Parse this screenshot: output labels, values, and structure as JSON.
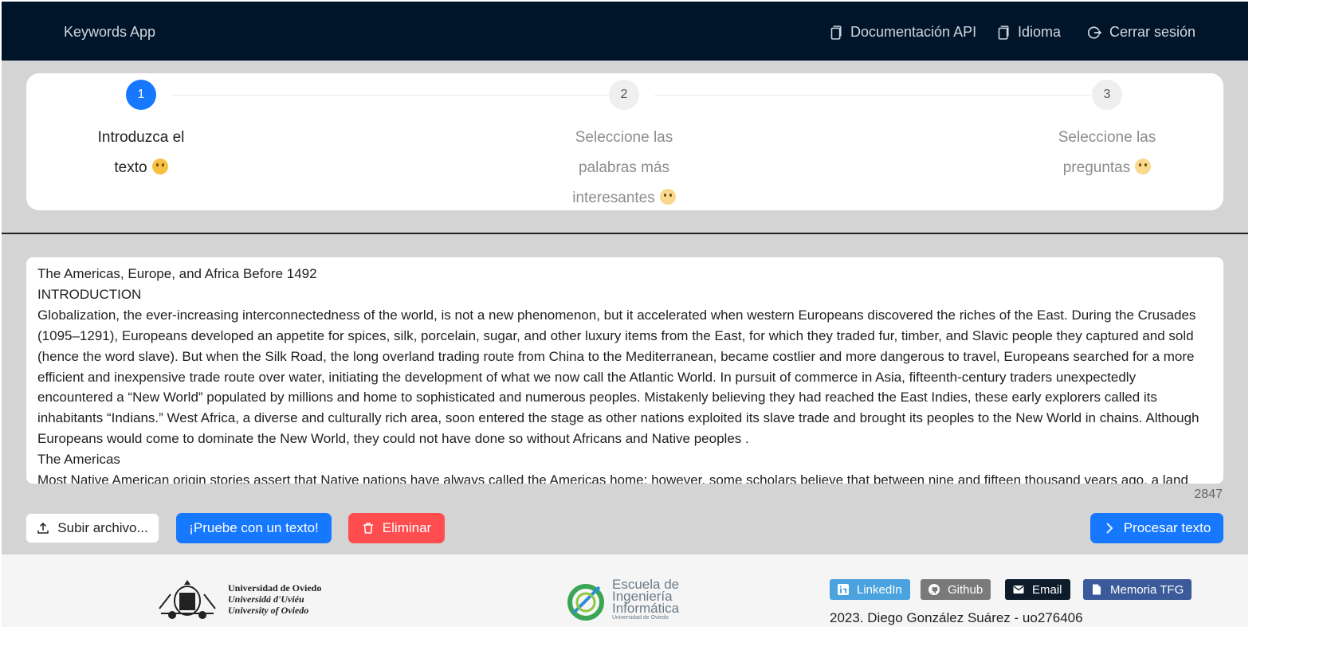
{
  "header": {
    "brand": "Keywords App",
    "nav": [
      {
        "label": "Documentación API",
        "icon": "document-icon"
      },
      {
        "label": "Idioma",
        "icon": "document-icon"
      },
      {
        "label": "Cerrar sesión",
        "icon": "logout-icon"
      }
    ]
  },
  "steps": [
    {
      "number": "1",
      "label_line1": "Introduzca el",
      "label_line2": "texto",
      "state": "active"
    },
    {
      "number": "2",
      "label_line1": "Seleccione las",
      "label_line2": "palabras más",
      "label_line3": "interesantes",
      "state": "pending"
    },
    {
      "number": "3",
      "label_line1": "Seleccione las",
      "label_line2": "preguntas",
      "state": "pending"
    }
  ],
  "text_input": {
    "paragraphs": [
      "The Americas, Europe, and Africa Before 1492",
      "INTRODUCTION",
      "Globalization, the ever-increasing interconnectedness of the world, is not a new phenomenon, but it accelerated when western Europeans discovered the riches of the East. During the Crusades (1095–1291), Europeans developed an appetite for spices, silk, porcelain, sugar, and other luxury items from the East, for which they traded fur, timber, and Slavic people they captured and sold (hence the word slave). But when the Silk Road, the long overland trading route from China to the Mediterranean, became costlier and more dangerous to travel, Europeans searched for a more efficient and inexpensive trade route over water, initiating the development of what we now call the Atlantic World. In pursuit of commerce in Asia, fifteenth-century traders unexpectedly encountered a “New World” populated by millions and home to sophisticated and numerous peoples. Mistakenly believing they had reached the East Indies, these early explorers called its inhabitants “Indians.” West Africa, a diverse and culturally rich area, soon entered the stage as other nations exploited its slave trade and brought its peoples to the New World in chains. Although Europeans would come to dominate the New World, they could not have done so without Africans and Native peoples .",
      "The Americas",
      "Most Native American origin stories assert that Native nations have always called the Americas home; however, some scholars believe that between nine and fifteen thousand years ago, a land bridge"
    ],
    "char_count": "2847"
  },
  "actions": {
    "upload": "Subir archivo...",
    "try_text": "¡Pruebe con un texto!",
    "delete": "Eliminar",
    "process": "Procesar texto"
  },
  "footer": {
    "university": [
      "Universidad de Oviedo",
      "Universidá d'Uviéu",
      "University of Oviedo"
    ],
    "school": [
      "Escuela de",
      "Ingeniería",
      "Informática",
      "Universidad de Oviedo"
    ],
    "links": [
      {
        "label": "LinkedIn",
        "color": "#4aa3df"
      },
      {
        "label": "Github",
        "color": "#7a7a7a"
      },
      {
        "label": "Email",
        "color": "#0d1b2a"
      },
      {
        "label": "Memoria TFG",
        "color": "#3b5a9a"
      }
    ],
    "credits": "2023. Diego González Suárez - uo276406"
  }
}
